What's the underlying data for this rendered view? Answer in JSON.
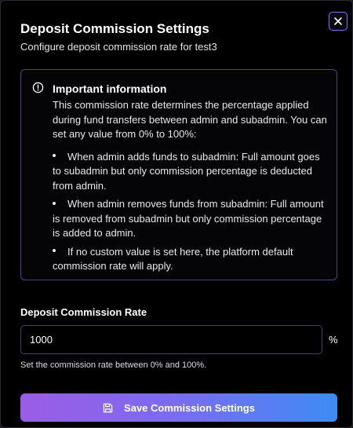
{
  "dialog": {
    "title": "Deposit Commission Settings",
    "subtitle": "Configure deposit commission rate for test3",
    "close_icon": "x-icon"
  },
  "info": {
    "icon": "info-circle-icon",
    "title": "Important information",
    "intro": "This commission rate determines the percentage applied during fund transfers between admin and subadmin. You can set any value from 0% to 100%:",
    "items": [
      "When admin adds funds to subadmin: Full amount goes to subadmin but only commission percentage is deducted from admin.",
      "When admin removes funds from subadmin: Full amount is removed from subadmin but only commission percentage is added to admin.",
      "If no custom value is set here, the platform default commission rate will apply."
    ]
  },
  "form": {
    "label": "Deposit Commission Rate",
    "value": "1000",
    "unit": "%",
    "helper": "Set the commission rate between 0% and 100%."
  },
  "actions": {
    "save_label": "Save Commission Settings",
    "save_icon": "save-icon"
  },
  "colors": {
    "background": "#000000",
    "accent_border": "#8b6cf6",
    "gradient_start": "#9b5de5",
    "gradient_end": "#3d8cf5"
  }
}
